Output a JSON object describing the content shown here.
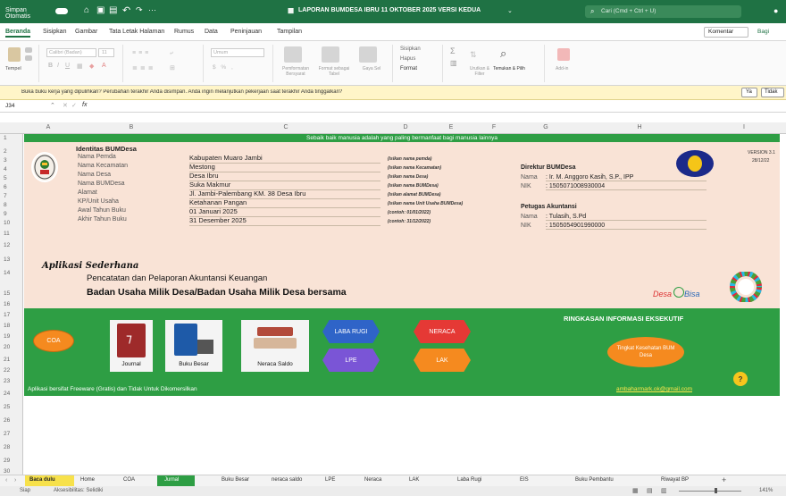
{
  "titlebar": {
    "autosave": "Simpan Otomatis",
    "title": "LAPORAN BUMDESA IBRU 11 OKTOBER 2025 VERSI KEDUA",
    "search": "Cari (Cmd + Ctrl + U)"
  },
  "ribbon_tabs": [
    "Beranda",
    "Sisipkan",
    "Gambar",
    "Tata Letak Halaman",
    "Rumus",
    "Data",
    "Peninjauan",
    "Tampilan"
  ],
  "ribbon": {
    "comment": "Komentar",
    "share": "Bagi",
    "paste": "Tempel",
    "font_name": "Calibri (Badan)",
    "font_size": "11",
    "number_format": "Umum",
    "insert": "Sisipkan",
    "delete": "Hapus",
    "format": "Format",
    "sort": "Urutkan & Filter",
    "find": "Temukan & Pilih",
    "cond_format": "Pemformatan Bersyarat",
    "table_format": "Format sebagai Tabel",
    "cell_styles": "Gaya Sel",
    "addins": "Add-in"
  },
  "message_bar": {
    "text": "Buka buku kerja yang dipulihkan?  Perubahan terakhir Anda disimpan. Anda ingin melanjutkan pekerjaan saat terakhir Anda tinggalkan?",
    "yes": "Ya",
    "no": "Tidak"
  },
  "formula_bar": {
    "cell": "J34",
    "fx": "fx",
    "value": ""
  },
  "columns": [
    "A",
    "B",
    "C",
    "D",
    "E",
    "F",
    "G",
    "H",
    "I"
  ],
  "rows": [
    "1",
    "2",
    "3",
    "4",
    "5",
    "6",
    "7",
    "8",
    "9",
    "10",
    "11",
    "12",
    "13",
    "14",
    "15",
    "16",
    "17",
    "18",
    "19",
    "20",
    "21",
    "22",
    "23",
    "24",
    "25",
    "26",
    "27",
    "28",
    "29",
    "30"
  ],
  "sheet": {
    "banner": "Sebaik baik manusia adalah yang paling bermanfaat bagi manusia lainnya",
    "identity_title": "Identitas BUMDesa",
    "identity": [
      {
        "label": "Nama Pemda",
        "value": "Kabupaten Muaro Jambi",
        "hint": "(isikan nama pemda)"
      },
      {
        "label": "Nama Kecamatan",
        "value": "Mestong",
        "hint": "(isikan nama Kecamatan)"
      },
      {
        "label": "Nama Desa",
        "value": "Desa Ibru",
        "hint": "(isikan nama Desa)"
      },
      {
        "label": "Nama BUMDesa",
        "value": "Suka Makmur",
        "hint": "(isikan nama BUMDesa)"
      },
      {
        "label": "Alamat",
        "value": "Jl. Jambi-Palembang KM. 38 Desa Ibru",
        "hint": "(isikan alamat BUMDesa)"
      },
      {
        "label": "KP/Unit Usaha",
        "value": "Ketahanan Pangan",
        "hint": "(isikan nama Unit Usaha BUMDesa)"
      },
      {
        "label": "Awal Tahun Buku",
        "value": "01 Januari 2025",
        "hint": "(contoh: 01/01/2022)"
      },
      {
        "label": "Akhir Tahun Buku",
        "value": "31 Desember 2025",
        "hint": "(contoh: 31/12/2022)"
      }
    ],
    "director": {
      "title": "Direktur BUMDesa",
      "name_label": "Nama",
      "name": ": Ir. M. Anggoro Kasih, S.P., IPP",
      "nik_label": "NIK",
      "nik": ": 1505071008930004"
    },
    "accountant": {
      "title": "Petugas Akuntansi",
      "name_label": "Nama",
      "name": ": Tulasih, S.Pd",
      "nik_label": "NIK",
      "nik": ": 1505054901990000"
    },
    "version": "VERSION 3.1",
    "version_date": "28/12/22",
    "app_title": "Aplikasi Sederhana",
    "app_sub1": "Pencatatan dan Pelaporan Akuntansi Keuangan",
    "app_sub2": "Badan Usaha Milik Desa/Badan Usaha Milik Desa bersama",
    "desa_logo_a": "Desa",
    "desa_logo_b": "Bisa",
    "nav": {
      "coa": "COA",
      "journal": "Journal",
      "buku_besar": "Buku Besar",
      "neraca_saldo": "Neraca Saldo",
      "laba_rugi": "LABA RUGI",
      "neraca": "NERACA",
      "lpe": "LPE",
      "lak": "LAK"
    },
    "summary_title": "RINGKASAN INFORMASI EKSEKUTIF",
    "health_btn": "Tingkat Kesehatan BUM Desa",
    "footer_note": "Aplikasi bersifat Freeware (Gratis) dan Tidak Untuk Dikomersilkan",
    "email": "ambaharmark.ok@gmail.com",
    "help": "?"
  },
  "sheet_tabs": [
    "Baca dulu",
    "Home",
    "COA",
    "Jurnal",
    "Buku Besar",
    "neraca saldo",
    "LPE",
    "Neraca",
    "LAK",
    "Laba Rugi",
    "EIS",
    "Buku Pembantu",
    "Riwayat BP"
  ],
  "status": {
    "ready": "Siap",
    "accessibility": "Aksesibilitas: Selidiki",
    "zoom": "141%"
  },
  "colors": {
    "excel_green": "#1f7244",
    "sheet_green": "#2e9e44",
    "peach": "#f9e3d6",
    "orange": "#f58a1f",
    "blue": "#2f64c8",
    "red": "#e53935",
    "purple": "#7a55d6"
  }
}
